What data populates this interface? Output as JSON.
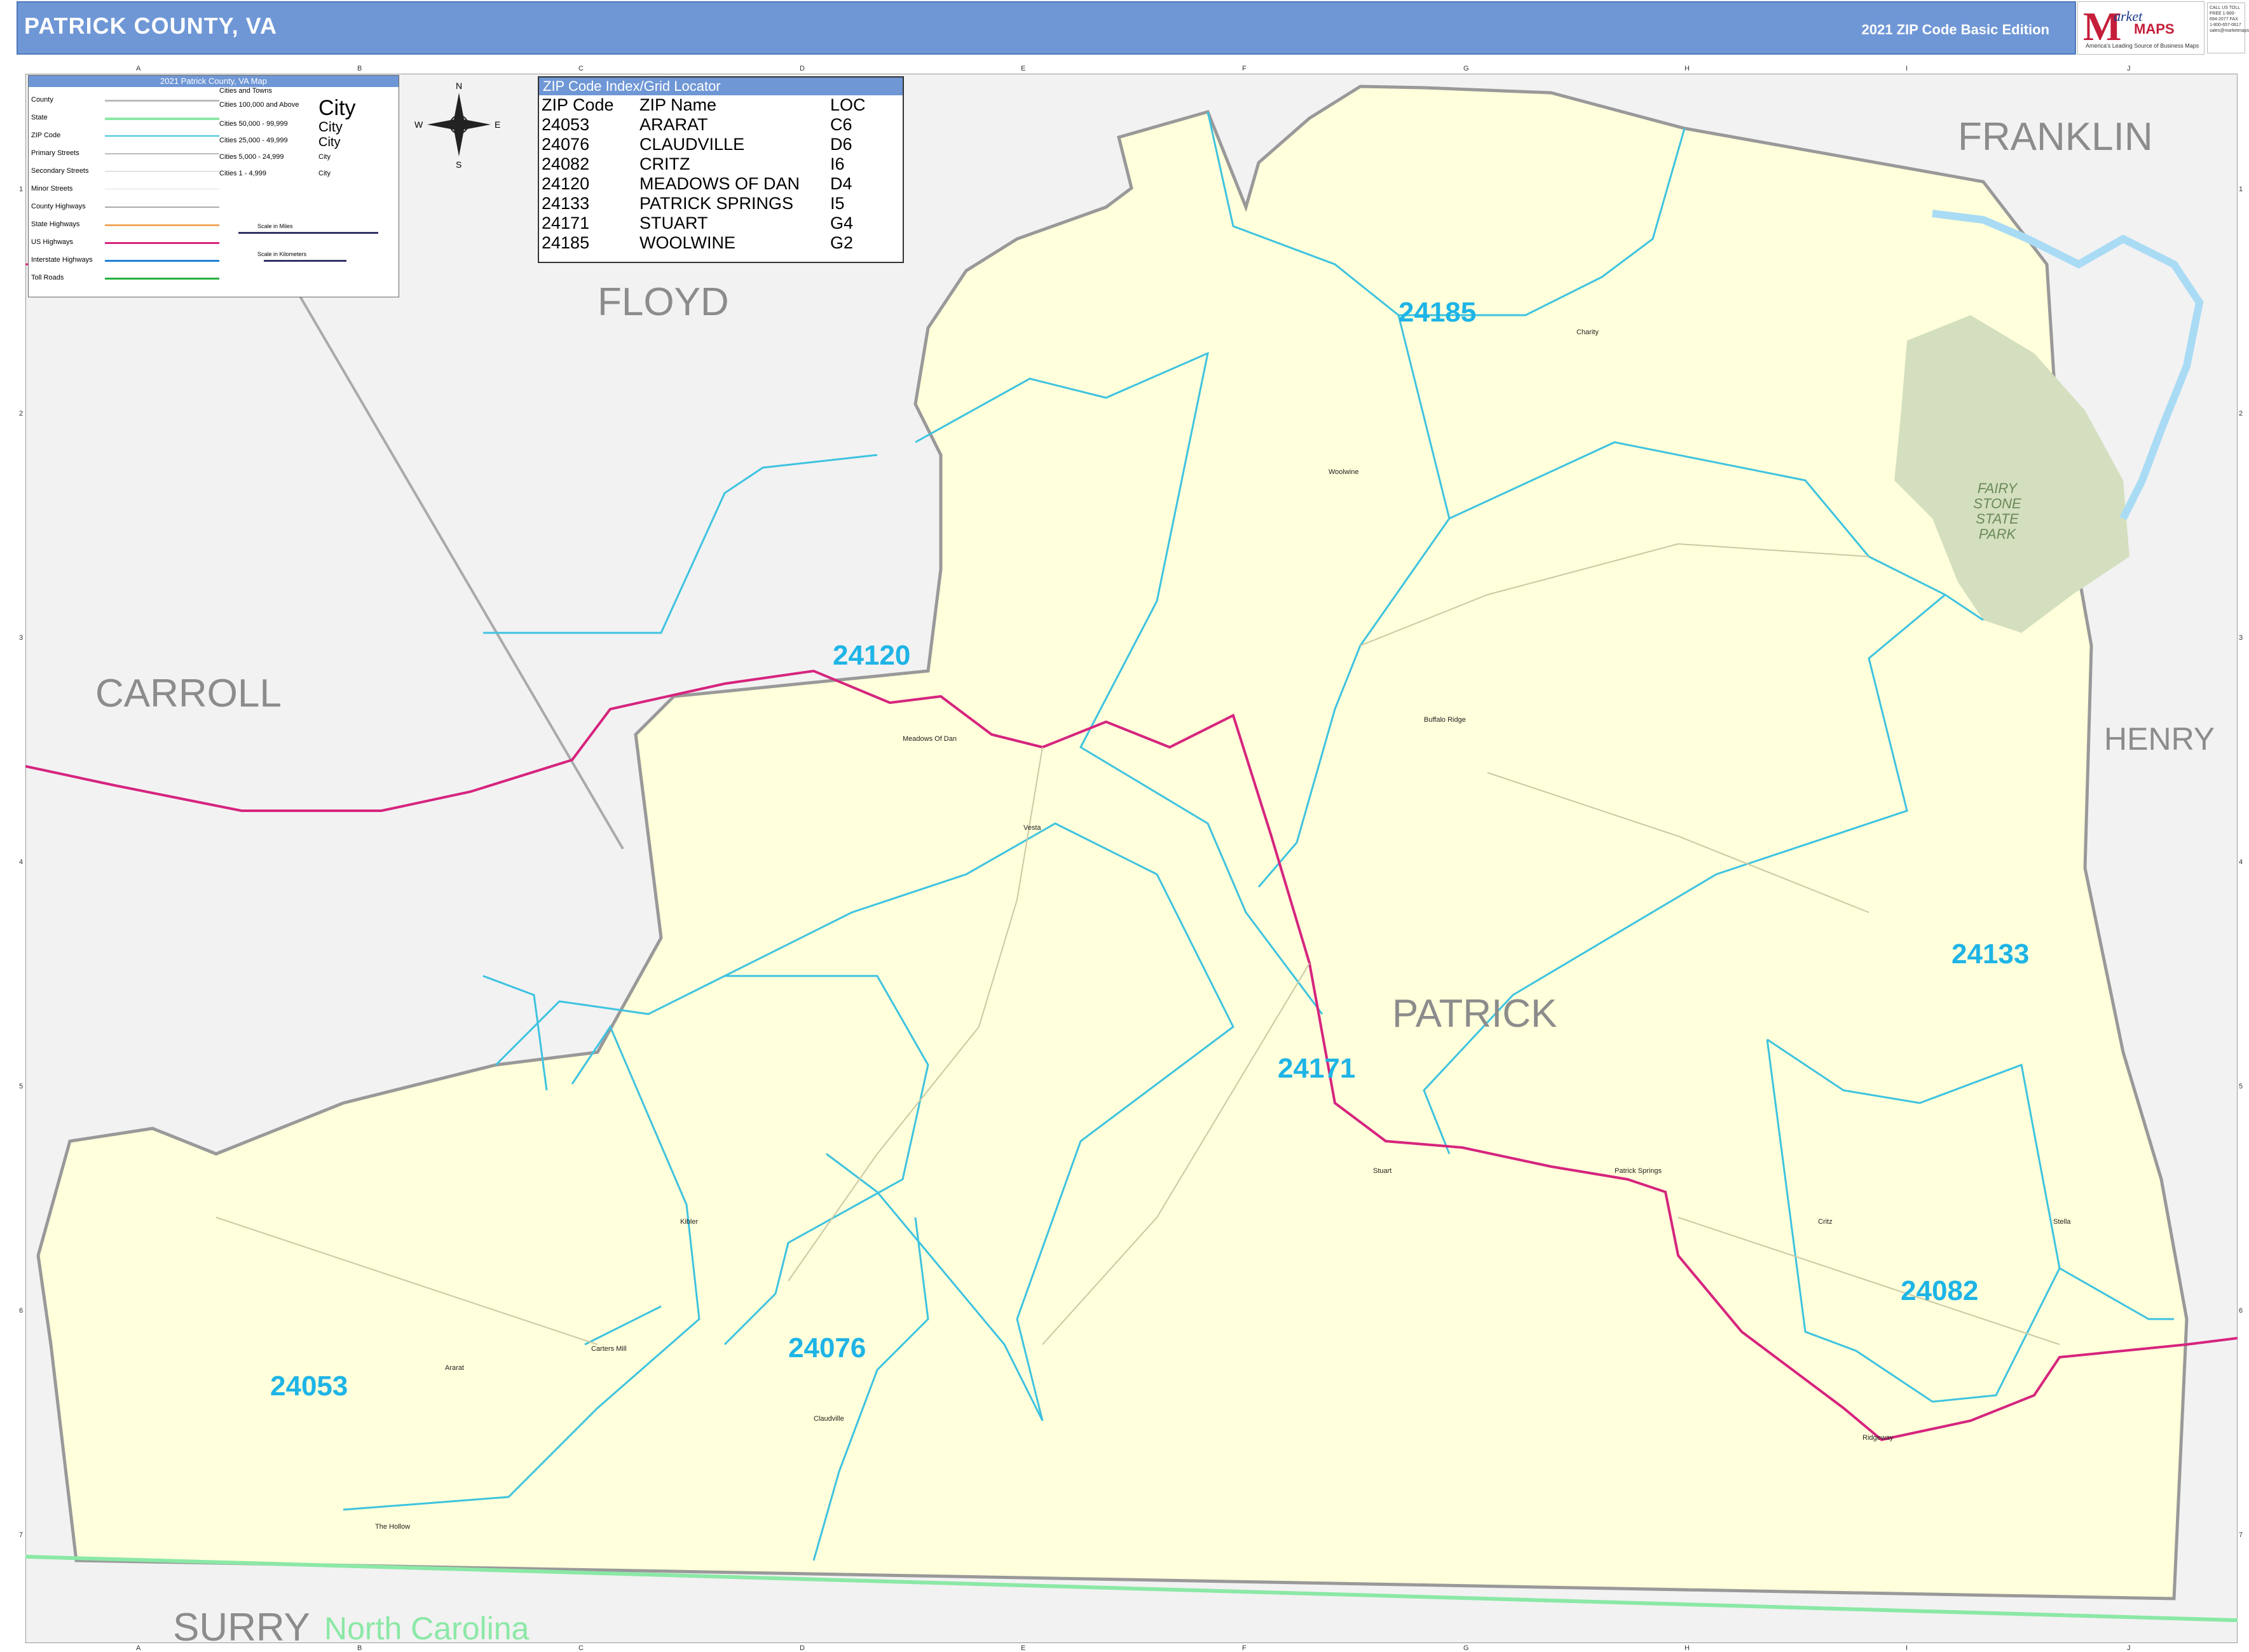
{
  "header": {
    "title": "PATRICK COUNTY, VA",
    "edition": "2021 ZIP Code Basic Edition"
  },
  "logo": {
    "m": "M",
    "market": "arket",
    "maps": "MAPS",
    "tagline": "America's Leading Source of Business Maps",
    "contact": "CALL US TOLL FREE 1-800-694-2077 FAX 1-800-657-0617 sales@marketmaps.com"
  },
  "legend": {
    "title": "2021 Patrick County, VA Map",
    "items": [
      "County",
      "State",
      "ZIP Code",
      "Primary Streets",
      "Secondary Streets",
      "Minor Streets",
      "County Highways",
      "State Highways",
      "US Highways",
      "Interstate Highways",
      "Toll Roads"
    ],
    "cities_header": "Cities and Towns",
    "city_sizes": [
      "Cities 100,000 and Above",
      "Cities 50,000 - 99,999",
      "Cities 25,000 - 49,999",
      "Cities 5,000 - 24,999",
      "Cities 1 - 4,999"
    ],
    "city_word": "City",
    "scale_miles": "Scale in Miles",
    "scale_km": "Scale in Kilometers"
  },
  "compass": {
    "n": "N",
    "s": "S",
    "e": "E",
    "w": "W"
  },
  "zip_index": {
    "title": "ZIP Code Index/Grid Locator",
    "columns": [
      "ZIP Code",
      "ZIP Name",
      "LOC"
    ],
    "rows": [
      [
        "24053",
        "ARARAT",
        "C6"
      ],
      [
        "24076",
        "CLAUDVILLE",
        "D6"
      ],
      [
        "24082",
        "CRITZ",
        "I6"
      ],
      [
        "24120",
        "MEADOWS OF DAN",
        "D4"
      ],
      [
        "24133",
        "PATRICK SPRINGS",
        "I5"
      ],
      [
        "24171",
        "STUART",
        "G4"
      ],
      [
        "24185",
        "WOOLWINE",
        "G2"
      ]
    ]
  },
  "counties": {
    "floyd": "FLOYD",
    "franklin": "FRANKLIN",
    "carroll": "CARROLL",
    "henry": "HENRY",
    "patrick": "PATRICK",
    "surry": "SURRY",
    "north_carolina": "North Carolina"
  },
  "zips": {
    "z24185": "24185",
    "z24120": "24120",
    "z24133": "24133",
    "z24171": "24171",
    "z24082": "24082",
    "z24076": "24076",
    "z24053": "24053"
  },
  "park": {
    "line1": "FAIRY",
    "line2": "STONE",
    "line3": "STATE",
    "line4": "PARK"
  },
  "towns": {
    "charity": "Charity",
    "woolwine": "Woolwine",
    "buffalo_ridge": "Buffalo Ridge",
    "meadows_of_dan": "Meadows Of Dan",
    "vesta": "Vesta",
    "stuart": "Stuart",
    "patrick_springs": "Patrick Springs",
    "critz": "Critz",
    "stella": "Stella",
    "kibler": "Kibler",
    "carters_mill": "Carters Mill",
    "ararat": "Ararat",
    "claudville": "Claudville",
    "the_hollow": "The Hollow",
    "ridgeway": "Ridgeway"
  },
  "grid": {
    "cols": [
      "A",
      "B",
      "C",
      "D",
      "E",
      "F",
      "G",
      "H",
      "I",
      "J"
    ],
    "rows": [
      "1",
      "2",
      "3",
      "4",
      "5",
      "6",
      "7"
    ]
  },
  "colors": {
    "header": "#6f97d6",
    "county_fill": "#ffffdb",
    "zip_line": "#3ec3e0",
    "us_highway": "#d6247e",
    "state_line": "#8be8a6",
    "park": "#d4dfbf"
  }
}
